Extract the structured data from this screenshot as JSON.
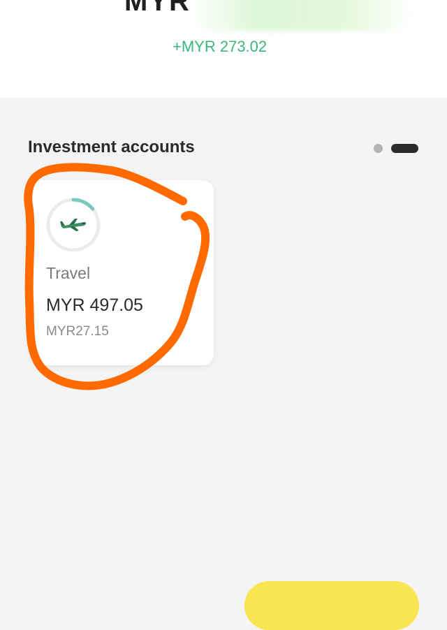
{
  "header": {
    "currency": "MYR",
    "change": "+MYR 273.02"
  },
  "section": {
    "title": "Investment accounts",
    "pager": {
      "count": 2,
      "active_index": 1
    }
  },
  "accounts": [
    {
      "name": "Travel",
      "value": "MYR 497.05",
      "gain": "MYR27.15",
      "icon": "airplane-icon",
      "progress_fraction": 0.14
    }
  ],
  "colors": {
    "positive": "#3bb77e",
    "progress": "#7cc7bf",
    "annotation": "#ff6a00",
    "action": "#f9e451"
  }
}
